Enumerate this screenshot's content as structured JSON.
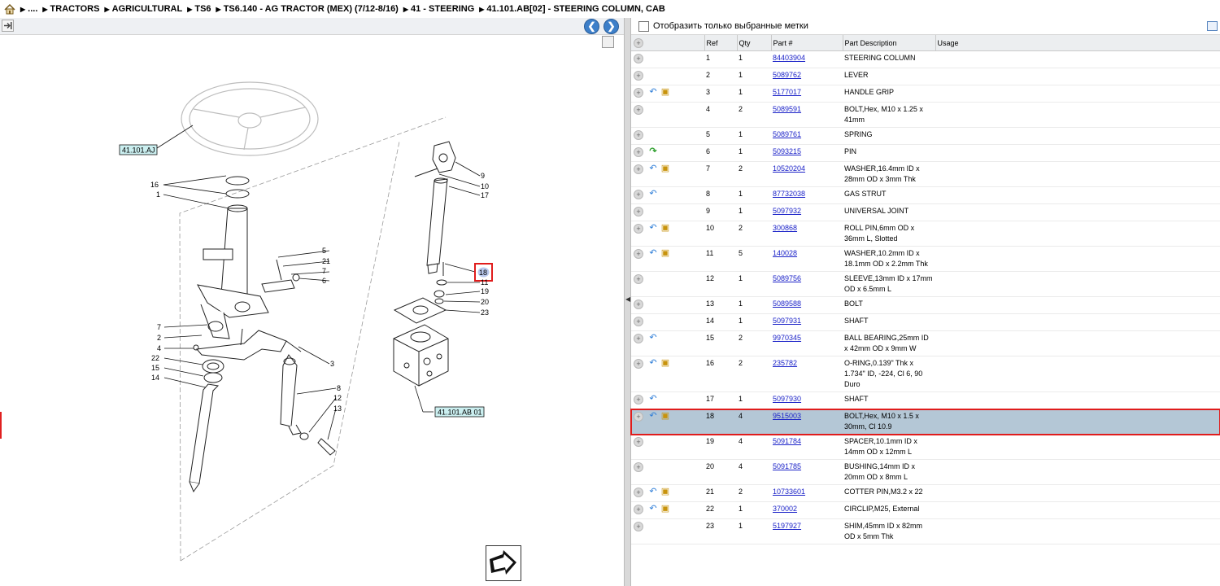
{
  "breadcrumb": [
    {
      "label": "...."
    },
    {
      "label": "TRACTORS"
    },
    {
      "label": "AGRICULTURAL"
    },
    {
      "label": "TS6"
    },
    {
      "label": "TS6.140 - AG TRACTOR (MEX) (7/12-8/16)"
    },
    {
      "label": "41 - STEERING"
    },
    {
      "label": "41.101.AB[02] - STEERING COLUMN, CAB"
    }
  ],
  "diagram": {
    "ref_labels": {
      "aj": "41.101.AJ",
      "ab01": "41.101.AB 01",
      "selected": "18"
    },
    "callouts": [
      "16",
      "1",
      "5",
      "21",
      "7",
      "6",
      "7",
      "2",
      "4",
      "22",
      "15",
      "14",
      "3",
      "8",
      "12",
      "13",
      "9",
      "10",
      "17",
      "11",
      "19",
      "20",
      "23"
    ]
  },
  "filter": {
    "label": "Отобразить только выбранные метки",
    "checked": false
  },
  "columns": {
    "ref": "Ref",
    "qty": "Qty",
    "part": "Part #",
    "desc": "Part Description",
    "usage": "Usage"
  },
  "parts": [
    {
      "ref": "1",
      "qty": "1",
      "part": "84403904",
      "desc": "STEERING COLUMN",
      "icons": []
    },
    {
      "ref": "2",
      "qty": "1",
      "part": "5089762",
      "desc": "LEVER",
      "icons": []
    },
    {
      "ref": "3",
      "qty": "1",
      "part": "5177017",
      "desc": "HANDLE GRIP",
      "icons": [
        "back-arrow-icon",
        "package-icon"
      ]
    },
    {
      "ref": "4",
      "qty": "2",
      "part": "5089591",
      "desc": "BOLT,Hex, M10 x 1.25 x 41mm",
      "icons": []
    },
    {
      "ref": "5",
      "qty": "1",
      "part": "5089761",
      "desc": "SPRING",
      "icons": []
    },
    {
      "ref": "6",
      "qty": "1",
      "part": "5093215",
      "desc": "PIN",
      "icons": [
        "green-arrow-icon"
      ]
    },
    {
      "ref": "7",
      "qty": "2",
      "part": "10520204",
      "desc": "WASHER,16.4mm ID x 28mm OD x 3mm Thk",
      "icons": [
        "back-arrow-icon",
        "package-icon"
      ]
    },
    {
      "ref": "8",
      "qty": "1",
      "part": "87732038",
      "desc": "GAS STRUT",
      "icons": [
        "back-arrow-icon"
      ]
    },
    {
      "ref": "9",
      "qty": "1",
      "part": "5097932",
      "desc": "UNIVERSAL JOINT",
      "icons": []
    },
    {
      "ref": "10",
      "qty": "2",
      "part": "300868",
      "desc": "ROLL PIN,6mm OD x 36mm L, Slotted",
      "icons": [
        "back-arrow-icon",
        "package-icon"
      ]
    },
    {
      "ref": "11",
      "qty": "5",
      "part": "140028",
      "desc": "WASHER,10.2mm ID x 18.1mm OD x 2.2mm Thk",
      "icons": [
        "back-arrow-icon",
        "package-icon"
      ]
    },
    {
      "ref": "12",
      "qty": "1",
      "part": "5089756",
      "desc": "SLEEVE,13mm ID x 17mm OD x 6.5mm L",
      "icons": []
    },
    {
      "ref": "13",
      "qty": "1",
      "part": "5089588",
      "desc": "BOLT",
      "icons": []
    },
    {
      "ref": "14",
      "qty": "1",
      "part": "5097931",
      "desc": "SHAFT",
      "icons": []
    },
    {
      "ref": "15",
      "qty": "2",
      "part": "9970345",
      "desc": "BALL BEARING,25mm ID x 42mm OD x 9mm W",
      "icons": [
        "back-arrow-icon"
      ]
    },
    {
      "ref": "16",
      "qty": "2",
      "part": "235782",
      "desc": "O-RING,0.139\" Thk x 1.734\" ID, -224, Cl 6, 90 Duro",
      "icons": [
        "back-arrow-icon",
        "package-icon"
      ]
    },
    {
      "ref": "17",
      "qty": "1",
      "part": "5097930",
      "desc": "SHAFT",
      "icons": [
        "back-arrow-icon"
      ]
    },
    {
      "ref": "18",
      "qty": "4",
      "part": "9515003",
      "desc": "BOLT,Hex, M10 x 1.5 x 30mm, Cl 10.9",
      "icons": [
        "back-arrow-icon",
        "package-icon"
      ],
      "selected": true
    },
    {
      "ref": "19",
      "qty": "4",
      "part": "5091784",
      "desc": "SPACER,10.1mm ID x 14mm OD x 12mm L",
      "icons": []
    },
    {
      "ref": "20",
      "qty": "4",
      "part": "5091785",
      "desc": "BUSHING,14mm ID x 20mm OD x 8mm L",
      "icons": []
    },
    {
      "ref": "21",
      "qty": "2",
      "part": "10733601",
      "desc": "COTTER PIN,M3.2 x 22",
      "icons": [
        "back-arrow-icon",
        "package-icon"
      ]
    },
    {
      "ref": "22",
      "qty": "1",
      "part": "370002",
      "desc": "CIRCLIP,M25, External",
      "icons": [
        "back-arrow-icon",
        "package-icon"
      ]
    },
    {
      "ref": "23",
      "qty": "1",
      "part": "5197927",
      "desc": "SHIM,45mm ID x 82mm OD x 5mm Thk",
      "icons": []
    }
  ],
  "colors": {
    "selected_row_bg": "#b4c7d6",
    "highlight_border": "#e01c1c",
    "link": "#1b22c8",
    "nav_button": "#3d7fc9"
  }
}
